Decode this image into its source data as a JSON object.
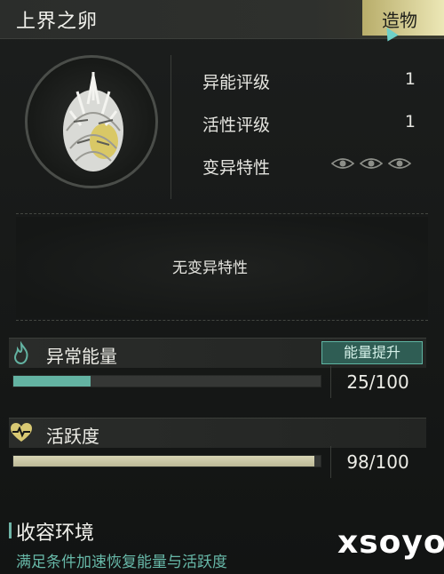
{
  "header": {
    "title": "上界之卵",
    "tag": "造物"
  },
  "stats": [
    {
      "label": "异能评级",
      "value": "1"
    },
    {
      "label": "活性评级",
      "value": "1"
    },
    {
      "label": "变异特性",
      "icon": "eye-icon"
    }
  ],
  "mutation": {
    "text": "无变异特性"
  },
  "energy": {
    "label": "异常能量",
    "button": "能量提升",
    "value": "25/100",
    "fraction": 0.25,
    "icon": "flame-icon",
    "color": "#63b3a2"
  },
  "vitality": {
    "label": "活跃度",
    "value": "98/100",
    "fraction": 0.98,
    "icon": "heart-pulse-icon",
    "color": "#c9c6a4"
  },
  "environment": {
    "title": "收容环境",
    "subtitle": "满足条件加速恢复能量与活跃度"
  },
  "watermark": "xsoyo"
}
